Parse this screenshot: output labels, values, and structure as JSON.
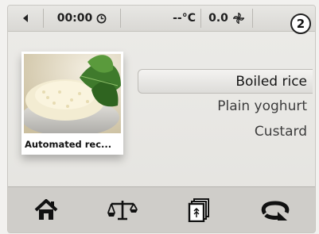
{
  "status_bar": {
    "time": "00:00",
    "temperature": "--°C",
    "fan_value": "0.0",
    "step_badge": "2",
    "icons": [
      "back-arrow-icon",
      "clock-icon",
      "fan-icon"
    ]
  },
  "recipe_tile": {
    "caption": "Automated rec..."
  },
  "recipe_list": {
    "items": [
      "Boiled rice",
      "Plain yoghurt",
      "Custard"
    ],
    "selected_index": 0
  },
  "bottom_bar": {
    "icons": [
      "home-icon",
      "scale-icon",
      "recipe-book-icon",
      "rotate-icon"
    ]
  },
  "colors": {
    "background": "#ecebe8",
    "bottom_bar": "#cfcdc9",
    "text": "#1e1e1e"
  }
}
